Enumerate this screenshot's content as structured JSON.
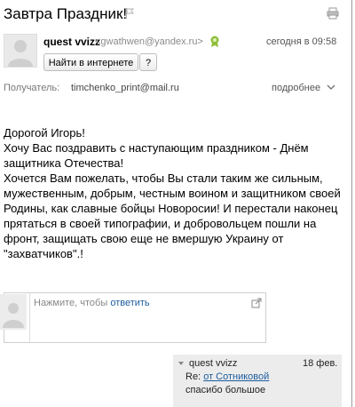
{
  "message": {
    "subject": "Завтра Праздник!",
    "sender_name": "quest vvizz",
    "sender_email": "<gwathwen@yandex.ru>",
    "date": "сегодня в 09:58",
    "search_button": "Найти в интернете",
    "help_button": "?",
    "recipient_label": "Получатель:",
    "recipient_email": "timchenko_print@mail.ru",
    "more_label": "подробнее",
    "body_lines": [
      "Дорогой Игорь!",
      "Хочу Вас поздравить с наступающим праздником - Днём защитника Отечества!",
      "Хочется Вам пожелать, чтобы Вы стали таким же сильным, мужественным, добрым, честным воином и защитником своей Родины, как славные бойцы Новоросии! И перестали наконец прятаться в своей типографии, и добровольцем пошли на фронт, защищать свою еще не вмершую Украину от \"захватчиков\".!"
    ]
  },
  "reply": {
    "prompt": "Нажмите, чтобы ",
    "link": "ответить"
  },
  "thread": {
    "name": "quest vvizz",
    "date": "18 фев.",
    "subject_prefix": "Re: ",
    "subject_link": "от Сотниковой",
    "snippet": "спасибо большое"
  },
  "colors": {
    "link": "#1d5d9e",
    "verify_icon": "#8fbf3a",
    "thread_bg": "#ececec"
  }
}
